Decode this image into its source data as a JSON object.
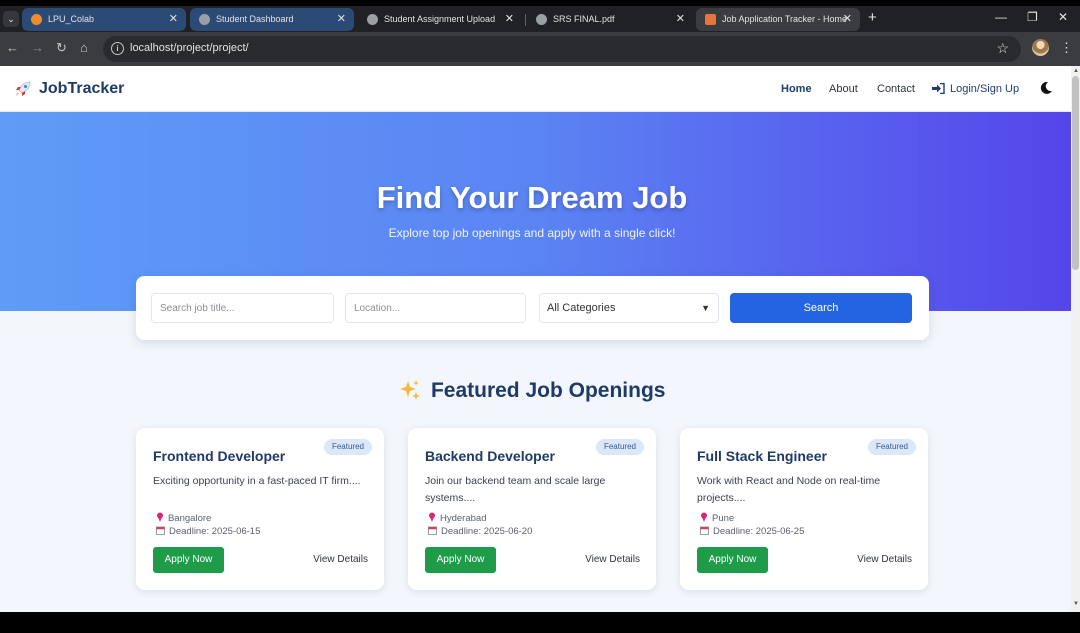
{
  "browser": {
    "tabs": [
      {
        "title": "LPU_Colab",
        "favicon_color": "#f28b30"
      },
      {
        "title": "Student Dashboard",
        "favicon_color": "#9aa0a6"
      },
      {
        "title": "Student Assignment Upload",
        "favicon_color": "#9aa0a6"
      },
      {
        "title": "SRS FINAL.pdf",
        "favicon_color": "#9aa0a6"
      },
      {
        "title": "Job Application Tracker - Home",
        "favicon_color": "#e8743b"
      }
    ],
    "url": "localhost/project/project/"
  },
  "navbar": {
    "brand": "JobTracker",
    "links": {
      "home": "Home",
      "about": "About",
      "contact": "Contact",
      "login": "Login/Sign Up"
    }
  },
  "hero": {
    "title": "Find Your Dream Job",
    "subtitle": "Explore top job openings and apply with a single click!"
  },
  "search": {
    "title_placeholder": "Search job title...",
    "location_placeholder": "Location...",
    "category_selected": "All Categories",
    "button_label": "Search"
  },
  "featured": {
    "heading": "Featured Job Openings",
    "jobs": [
      {
        "title": "Frontend Developer",
        "badge": "Featured",
        "description": "Exciting opportunity in a fast-paced IT firm....",
        "location": "Bangalore",
        "deadline": "Deadline: 2025-06-15",
        "apply_label": "Apply Now",
        "details_label": "View Details"
      },
      {
        "title": "Backend Developer",
        "badge": "Featured",
        "description": "Join our backend team and scale large systems....",
        "location": "Hyderabad",
        "deadline": "Deadline: 2025-06-20",
        "apply_label": "Apply Now",
        "details_label": "View Details"
      },
      {
        "title": "Full Stack Engineer",
        "badge": "Featured",
        "description": "Work with React and Node on real-time projects....",
        "location": "Pune",
        "deadline": "Deadline: 2025-06-25",
        "apply_label": "Apply Now",
        "details_label": "View Details"
      }
    ]
  },
  "colors": {
    "brand_navy": "#1e3a66",
    "search_blue": "#2364e3",
    "apply_green": "#1f9c4a",
    "hero_start": "#5e9cf7",
    "hero_end": "#5545ea"
  },
  "icons": [
    "rocket-icon",
    "login-icon",
    "moon-icon",
    "sparkle-icon",
    "pin-icon",
    "calendar-icon",
    "info-icon",
    "star-icon"
  ]
}
